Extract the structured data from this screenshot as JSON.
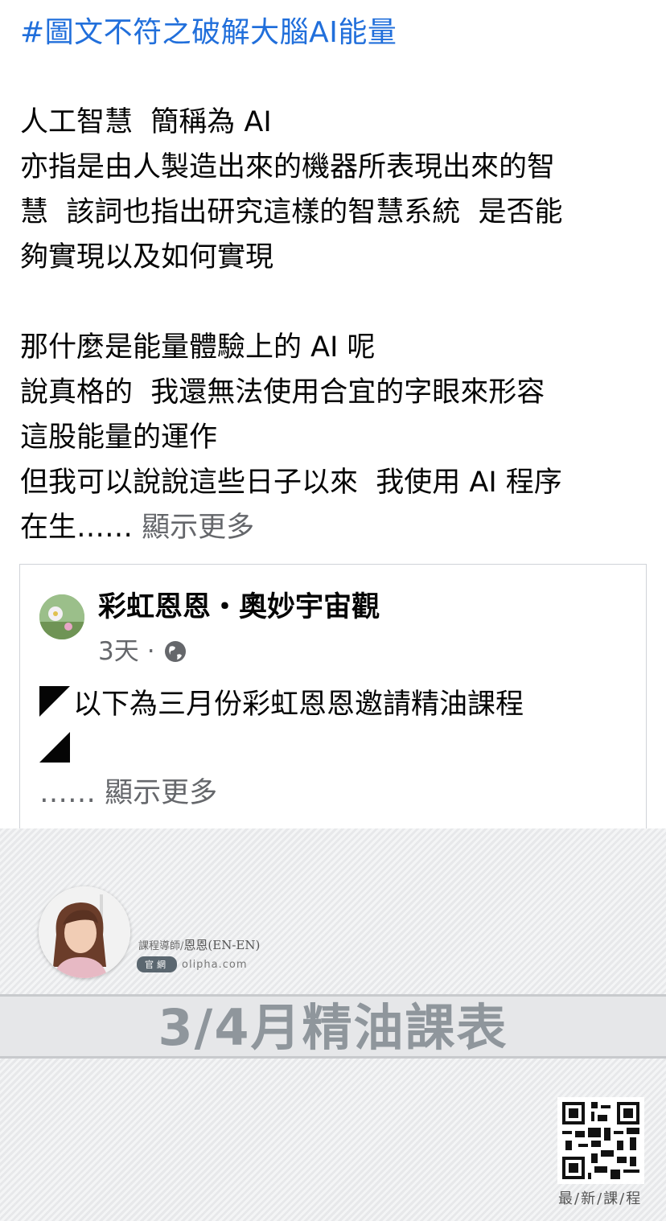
{
  "post": {
    "hashtag": "#圖文不符之破解大腦AI能量",
    "para1": [
      "人工智慧  簡稱為 AI",
      "亦指是由人製造出來的機器所表現出來的智",
      "慧  該詞也指出研究這樣的智慧系統  是否能",
      "夠實現以及如何實現"
    ],
    "para2": [
      "那什麼是能量體驗上的 AI 呢",
      "說真格的  我還無法使用合宜的字眼來形容",
      "這股能量的運作",
      "但我可以說說這些日子以來  我使用 AI 程序"
    ],
    "last_line_start": "在生……",
    "see_more": "顯示更多"
  },
  "shared_post": {
    "author": "彩虹恩恩・奧妙宇宙觀",
    "time": "3天",
    "separator": "·",
    "privacy_icon": "globe-icon",
    "text": "以下為三月份彩虹恩恩邀請精油課程",
    "ellipsis": "……",
    "see_more": "顯示更多"
  },
  "banner": {
    "tutor_prefix": "課程導師/",
    "tutor_name": "恩恩(EN-EN)",
    "site_label": "官網",
    "site_url": "olipha.com",
    "title": "3/4月精油課表",
    "qr_caption": "最/新/課/程"
  },
  "colors": {
    "hashtag": "#216fdb",
    "muted": "#65676b",
    "banner_title": "#8f969c"
  }
}
